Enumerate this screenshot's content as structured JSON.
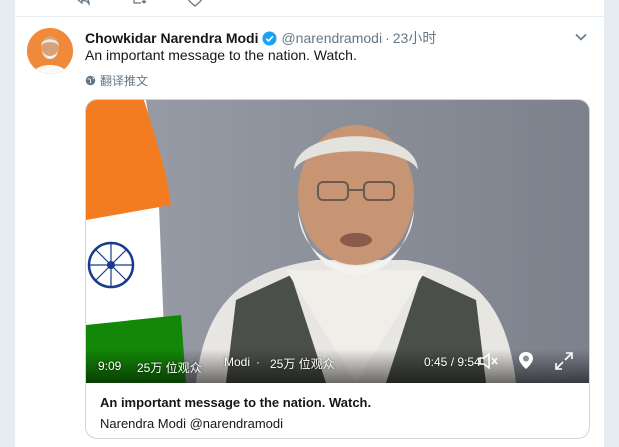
{
  "previous_tweet": {
    "reply_count": "",
    "retweet_count": "",
    "like_count": ""
  },
  "tweet": {
    "author_name": "Chowkidar Narendra Modi",
    "handle": "@narendramodi",
    "separator": "·",
    "time": "23小时",
    "text": "An important message to the nation. Watch.",
    "translate_label": "翻译推文"
  },
  "video": {
    "duration_badge": "9:09",
    "views_badge": "25万 位观众",
    "channel_label": "Modi",
    "views_label": "25万 位观众",
    "timestamp": "0:45 / 9:54"
  },
  "card": {
    "title": "An important message to the nation. Watch.",
    "subtitle": "Narendra Modi @narendramodi"
  },
  "colors": {
    "text": "#14171a",
    "secondary": "#657786",
    "verified": "#1da1f2",
    "border": "#ccd6dd",
    "flag_saffron": "#f47c20",
    "flag_green": "#138808",
    "chakra": "#1a3a8c"
  }
}
